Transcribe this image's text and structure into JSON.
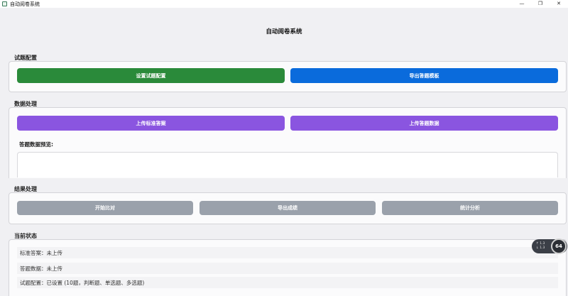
{
  "window": {
    "title": "自动阅卷系统",
    "minimize": "—",
    "restore": "❐",
    "close": "✕"
  },
  "header": {
    "title": "自动阅卷系统"
  },
  "config": {
    "label": "试题配置",
    "set_config_button": "设置试题配置",
    "export_template_button": "导出答题模板"
  },
  "data_processing": {
    "label": "数据处理",
    "upload_standard_button": "上传标准答案",
    "upload_answers_button": "上传答题数据",
    "preview_label": "答题数据预览:"
  },
  "result_processing": {
    "label": "结果处理",
    "start_compare_button": "开始比对",
    "export_scores_button": "导出成绩",
    "statistics_button": "统计分析"
  },
  "status": {
    "label": "当前状态",
    "rows": [
      "标准答案：未上传",
      "答题数据：未上传",
      "试题配置：已设置 (10题，判断题、单选题、多选题)"
    ]
  },
  "perf_widget": {
    "line1": "↑ 1.3",
    "line2": "↓ 1.3",
    "value": "64"
  },
  "colors": {
    "green": "#2a8a3a",
    "blue": "#0a6bdc",
    "purple": "#8a55e0",
    "gray": "#9aa1ab"
  },
  "icons": {
    "app": "app-icon",
    "minimize": "minimize-icon",
    "restore": "restore-icon",
    "close": "close-icon"
  }
}
